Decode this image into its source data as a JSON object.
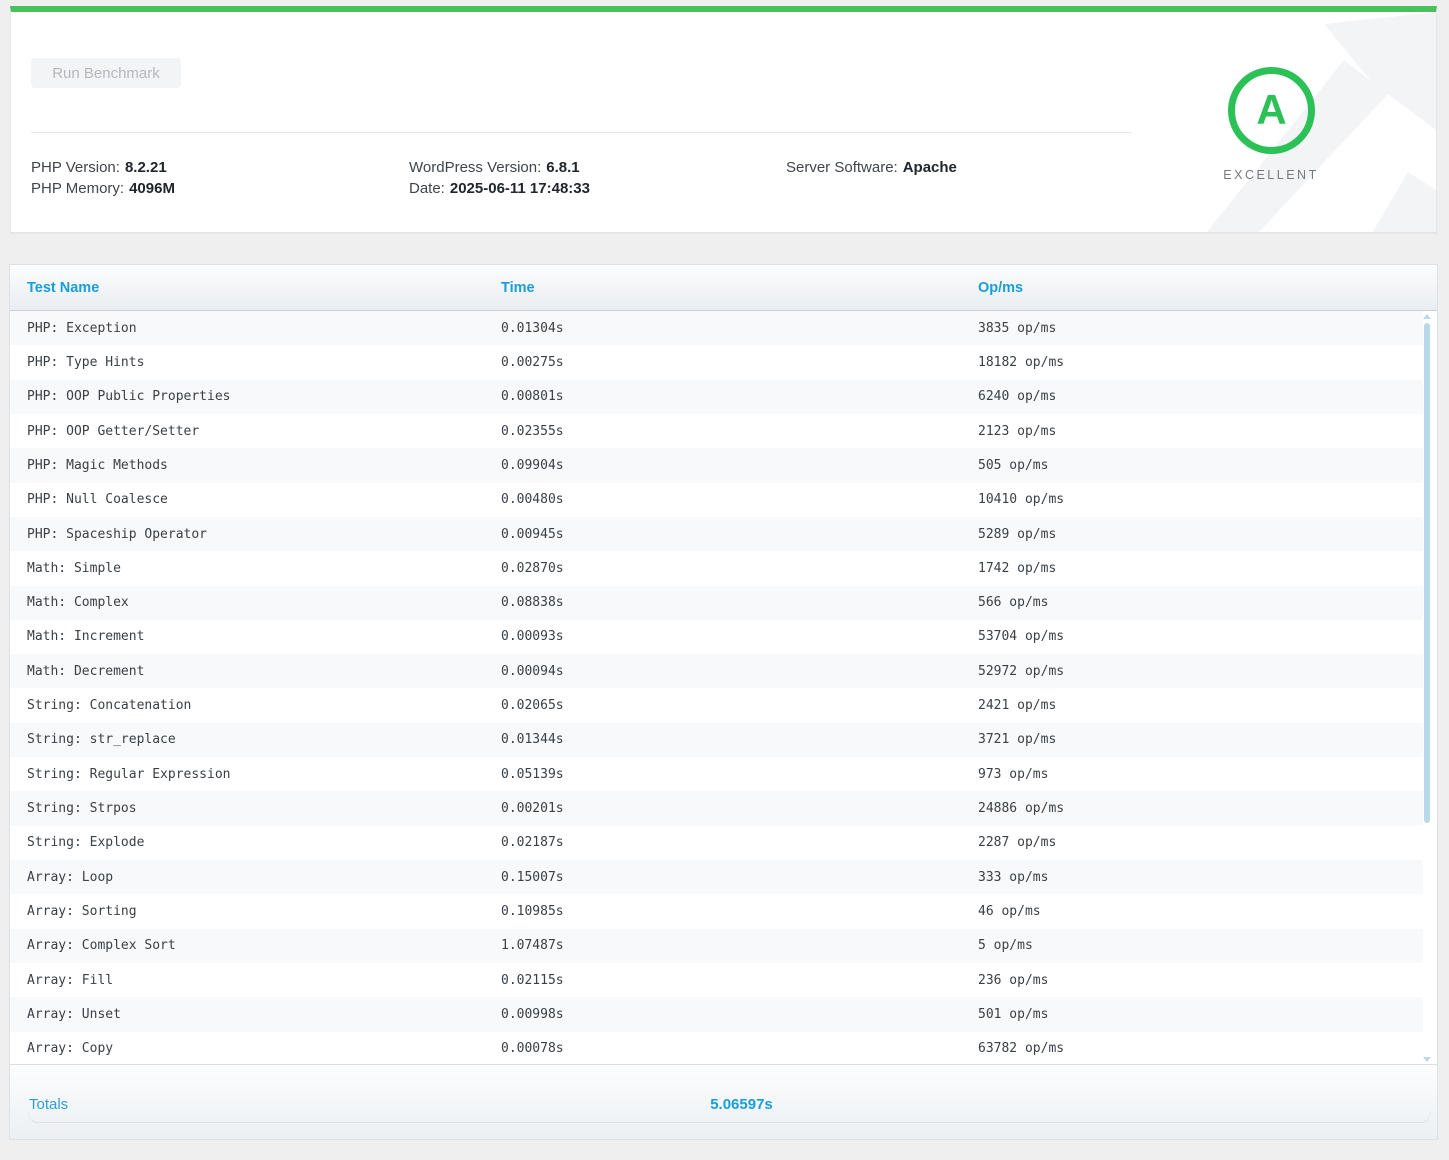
{
  "header": {
    "run_button_label": "Run Benchmark",
    "info": [
      {
        "items": [
          {
            "label": "PHP Version:",
            "value": "8.2.21"
          },
          {
            "label": "PHP Memory:",
            "value": "4096M"
          }
        ]
      },
      {
        "items": [
          {
            "label": "WordPress Version:",
            "value": "6.8.1"
          },
          {
            "label": "Date:",
            "value": "2025-06-11 17:48:33"
          }
        ]
      },
      {
        "items": [
          {
            "label": "Server Software:",
            "value": "Apache"
          }
        ]
      }
    ],
    "grade": {
      "letter": "A",
      "caption": "EXCELLENT"
    }
  },
  "table": {
    "columns": [
      "Test Name",
      "Time",
      "Op/ms"
    ],
    "rows": [
      {
        "name": "PHP: Exception",
        "time": "0.01304s",
        "ops": "3835 op/ms"
      },
      {
        "name": "PHP: Type Hints",
        "time": "0.00275s",
        "ops": "18182 op/ms"
      },
      {
        "name": "PHP: OOP Public Properties",
        "time": "0.00801s",
        "ops": "6240 op/ms"
      },
      {
        "name": "PHP: OOP Getter/Setter",
        "time": "0.02355s",
        "ops": "2123 op/ms"
      },
      {
        "name": "PHP: Magic Methods",
        "time": "0.09904s",
        "ops": "505 op/ms"
      },
      {
        "name": "PHP: Null Coalesce",
        "time": "0.00480s",
        "ops": "10410 op/ms"
      },
      {
        "name": "PHP: Spaceship Operator",
        "time": "0.00945s",
        "ops": "5289 op/ms"
      },
      {
        "name": "Math: Simple",
        "time": "0.02870s",
        "ops": "1742 op/ms"
      },
      {
        "name": "Math: Complex",
        "time": "0.08838s",
        "ops": "566 op/ms"
      },
      {
        "name": "Math: Increment",
        "time": "0.00093s",
        "ops": "53704 op/ms"
      },
      {
        "name": "Math: Decrement",
        "time": "0.00094s",
        "ops": "52972 op/ms"
      },
      {
        "name": "String: Concatenation",
        "time": "0.02065s",
        "ops": "2421 op/ms"
      },
      {
        "name": "String: str_replace",
        "time": "0.01344s",
        "ops": "3721 op/ms"
      },
      {
        "name": "String: Regular Expression",
        "time": "0.05139s",
        "ops": "973 op/ms"
      },
      {
        "name": "String: Strpos",
        "time": "0.00201s",
        "ops": "24886 op/ms"
      },
      {
        "name": "String: Explode",
        "time": "0.02187s",
        "ops": "2287 op/ms"
      },
      {
        "name": "Array: Loop",
        "time": "0.15007s",
        "ops": "333 op/ms"
      },
      {
        "name": "Array: Sorting",
        "time": "0.10985s",
        "ops": "46 op/ms"
      },
      {
        "name": "Array: Complex Sort",
        "time": "1.07487s",
        "ops": "5 op/ms"
      },
      {
        "name": "Array: Fill",
        "time": "0.02115s",
        "ops": "236 op/ms"
      },
      {
        "name": "Array: Unset",
        "time": "0.00998s",
        "ops": "501 op/ms"
      },
      {
        "name": "Array: Copy",
        "time": "0.00078s",
        "ops": "63782 op/ms"
      }
    ],
    "totals_label": "Totals",
    "total_time": "5.06597s"
  },
  "colors": {
    "accent_green_bar": "#48c15a",
    "accent_green_grade": "#2cc157",
    "accent_blue": "#189ed9",
    "row_stripe": "#f8f9fa",
    "scrollbar": "#b9d8ea",
    "page_background": "#efeff0"
  }
}
